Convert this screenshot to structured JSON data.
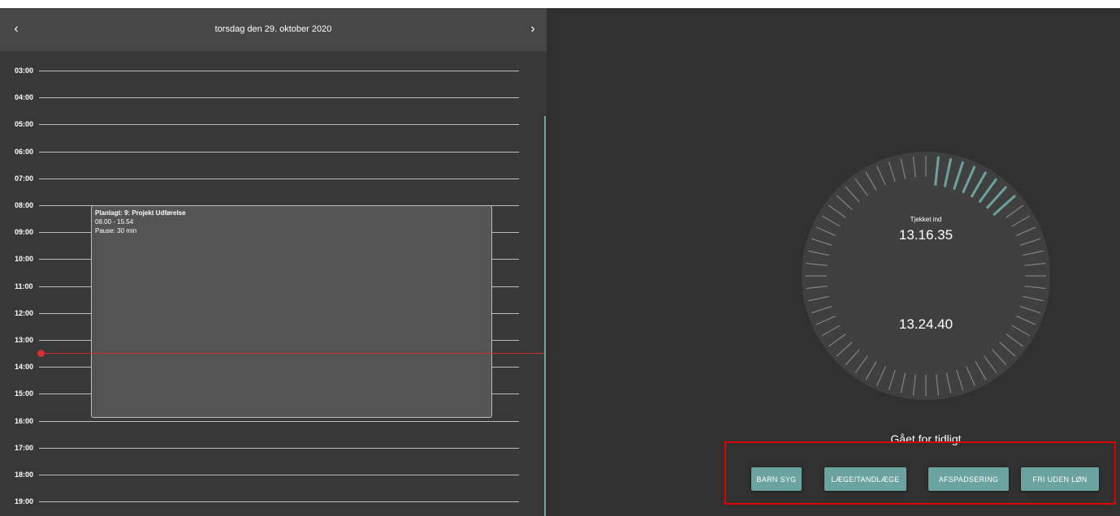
{
  "calendar": {
    "title": "torsdag den 29. oktober 2020",
    "prev_icon": "‹",
    "next_icon": "›",
    "hours": [
      "03:00",
      "04:00",
      "05:00",
      "06:00",
      "07:00",
      "08:00",
      "09:00",
      "10:00",
      "11:00",
      "12:00",
      "13:00",
      "14:00",
      "15:00",
      "16:00",
      "17:00",
      "18:00",
      "19:00"
    ],
    "event": {
      "title": "Planlagt: 9: Projekt Udførelse",
      "time": "08.00 - 15.54",
      "pause": "Pause: 30 min"
    }
  },
  "clock": {
    "label": "Tjekket ind",
    "checked_in_time": "13.16.35",
    "current_time": "13.24.40",
    "progress_fraction": 0.14
  },
  "early_leave": {
    "title": "Gået for tidligt",
    "buttons": [
      "BARN SYG",
      "LÆGE/TANDLÆGE",
      "AFSPADSERING",
      "FRI UDEN LØN"
    ]
  },
  "colors": {
    "accent": "#6aa39f",
    "now_indicator": "#d32f2f",
    "highlight_frame": "#e00000"
  }
}
